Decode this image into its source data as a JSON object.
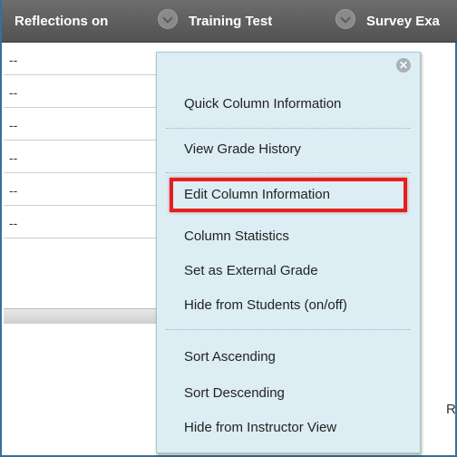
{
  "header": {
    "columns": [
      {
        "label": "Reflections on"
      },
      {
        "label": "Training Test"
      },
      {
        "label": "Survey Exa"
      }
    ]
  },
  "rows": [
    {
      "value": "--"
    },
    {
      "value": "--"
    },
    {
      "value": "--"
    },
    {
      "value": "--"
    },
    {
      "value": "--"
    },
    {
      "value": "--"
    }
  ],
  "right_edge_text": "R",
  "menu": {
    "close_glyph": "✕",
    "items": [
      {
        "label": "Quick Column Information"
      },
      {
        "label": "View Grade History"
      },
      {
        "label": "Edit Column Information"
      },
      {
        "label": "Column Statistics"
      },
      {
        "label": "Set as External Grade"
      },
      {
        "label": "Hide from Students (on/off)"
      },
      {
        "label": "Sort Ascending"
      },
      {
        "label": "Sort Descending"
      },
      {
        "label": "Hide from Instructor View"
      }
    ],
    "highlighted_item": "Edit Column Information",
    "highlight_color": "#e41f1f"
  },
  "colors": {
    "header_bg": "#5e5e5e",
    "menu_bg": "#dcedf4",
    "frame_border": "#3a6e95"
  }
}
